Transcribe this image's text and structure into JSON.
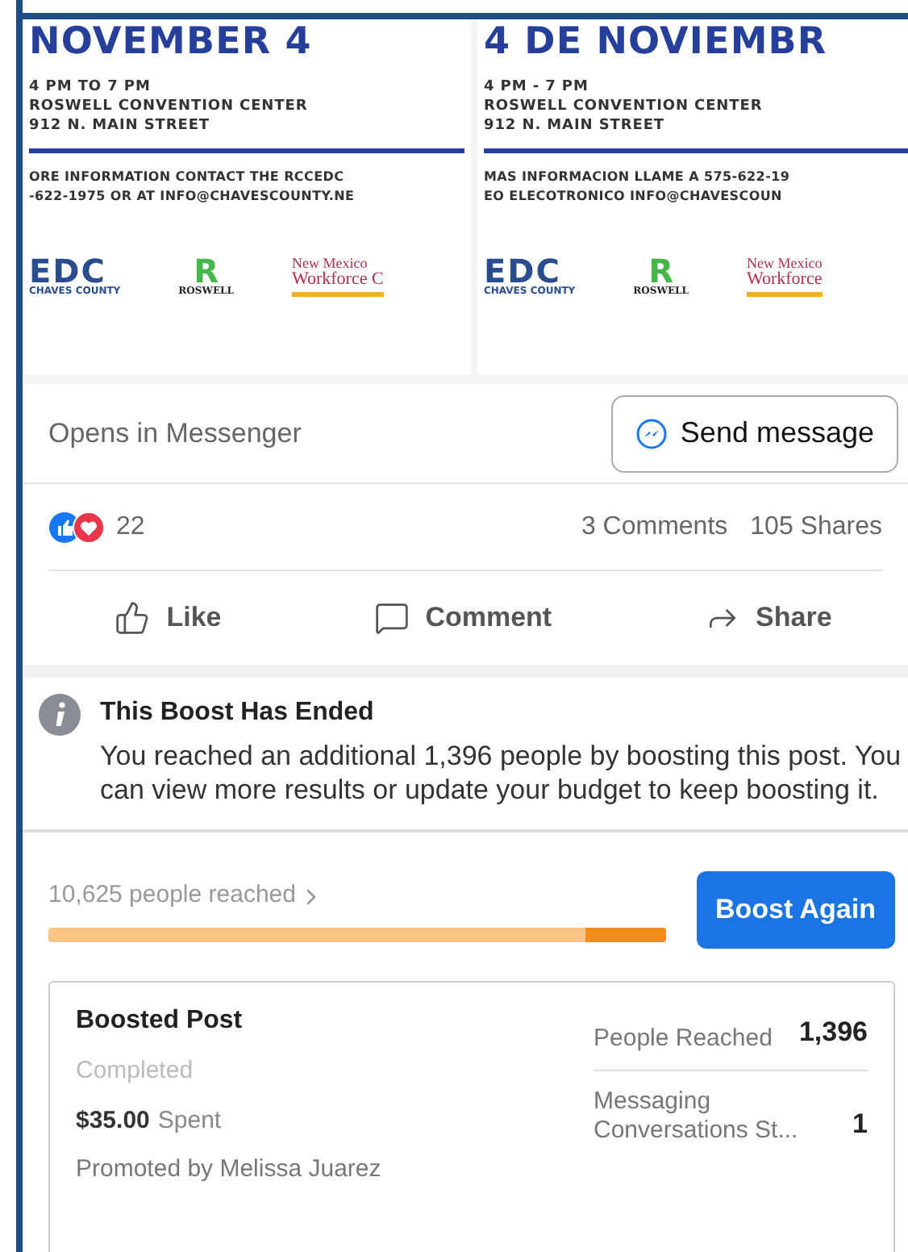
{
  "flyer": {
    "panels": [
      {
        "heading": "NOVEMBER 4",
        "lines": [
          "4 PM TO 7 PM",
          "ROSWELL CONVENTION CENTER",
          "912 N. MAIN STREET"
        ],
        "contact": [
          "ORE INFORMATION CONTACT THE RCCEDC",
          "-622-1975 OR AT INFO@CHAVESCOUNTY.NE"
        ],
        "logos": [
          {
            "kind": "edc",
            "text": "EDC",
            "sub": "CHAVES COUNTY"
          },
          {
            "kind": "roswell",
            "text": "R",
            "sub": "ROSWELL"
          },
          {
            "kind": "workforce",
            "text": "New Mexico",
            "sub": "Workforce C"
          }
        ]
      },
      {
        "heading": "4 DE NOVIEMBR",
        "lines": [
          "4 PM - 7 PM",
          "ROSWELL CONVENTION CENTER",
          "912 N. MAIN STREET"
        ],
        "contact": [
          "MAS INFORMACION LLAME A 575-622-19",
          "EO ELECOTRONICO INFO@CHAVESCOUN"
        ],
        "logos": [
          {
            "kind": "edc",
            "text": "EDC",
            "sub": "CHAVES COUNTY"
          },
          {
            "kind": "roswell",
            "text": "R",
            "sub": "ROSWELL"
          },
          {
            "kind": "workforce",
            "text": "New Mexico",
            "sub": "Workforce"
          }
        ]
      }
    ]
  },
  "messenger": {
    "caption": "Opens in Messenger",
    "button": "Send message"
  },
  "reactions": {
    "count": "22",
    "comments": "3 Comments",
    "shares": "105 Shares"
  },
  "actions": [
    "Like",
    "Comment",
    "Share"
  ],
  "notice": {
    "title": "This Boost Has Ended",
    "body": "You reached an additional 1,396 people by boosting this post. You can view more results or update your budget to keep boosting it."
  },
  "reach": {
    "label": "10,625 people reached",
    "segments": [
      {
        "level": 0.87,
        "color": "#f9c585"
      },
      {
        "level": 0.13,
        "color": "#ef8e1c"
      }
    ],
    "button": "Boost Again"
  },
  "card": {
    "title": "Boosted Post",
    "status": "Completed",
    "amount": "$35.00",
    "amount_label": "Spent",
    "promoted": "Promoted by Melissa Juarez",
    "stats": [
      {
        "label": "People Reached",
        "value": "1,396"
      },
      {
        "label": "Messaging Conversations St...",
        "value": "1"
      }
    ]
  }
}
